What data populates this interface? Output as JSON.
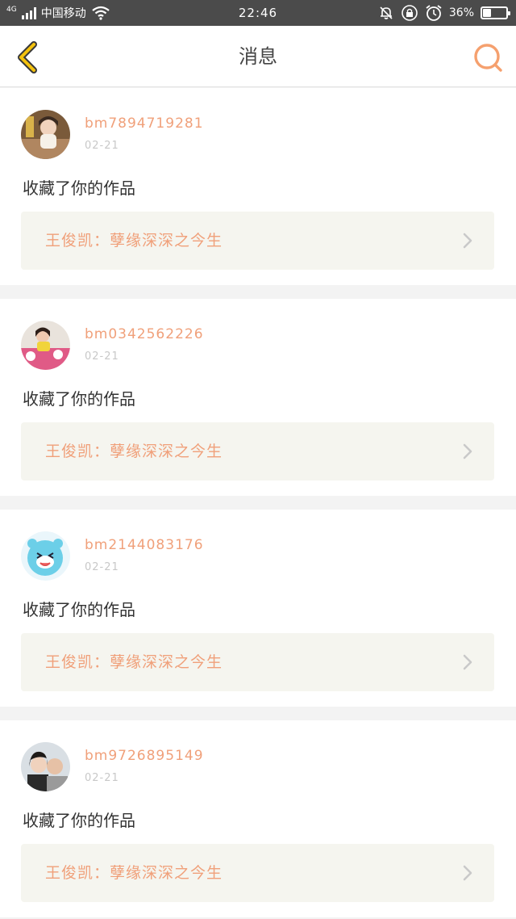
{
  "status_bar": {
    "network_type": "4G",
    "carrier": "中国移动",
    "time": "22:46",
    "battery_percent": "36%",
    "battery_level": 0.36,
    "icons": [
      "signal-icon",
      "wifi-icon",
      "mute-icon",
      "rotation-lock-icon",
      "alarm-icon",
      "battery-icon"
    ]
  },
  "nav": {
    "title": "消息",
    "back_icon": "chevron-left-icon",
    "search_icon": "search-icon",
    "back_color": "#f4c20d",
    "search_color": "#f5a06e"
  },
  "accent_color": "#f0a07a",
  "messages": [
    {
      "username": "bm7894719281",
      "date": "02-21",
      "action": "收藏了你的作品",
      "work_title": "王俊凯：孽缘深深之今生",
      "avatar_kind": "photo-girl-table"
    },
    {
      "username": "bm0342562226",
      "date": "02-21",
      "action": "收藏了你的作品",
      "work_title": "王俊凯：孽缘深深之今生",
      "avatar_kind": "photo-pink-toys"
    },
    {
      "username": "bm2144083176",
      "date": "02-21",
      "action": "收藏了你的作品",
      "work_title": "王俊凯：孽缘深深之今生",
      "avatar_kind": "cartoon-blue-face"
    },
    {
      "username": "bm9726895149",
      "date": "02-21",
      "action": "收藏了你的作品",
      "work_title": "王俊凯：孽缘深深之今生",
      "avatar_kind": "photo-couple"
    }
  ]
}
